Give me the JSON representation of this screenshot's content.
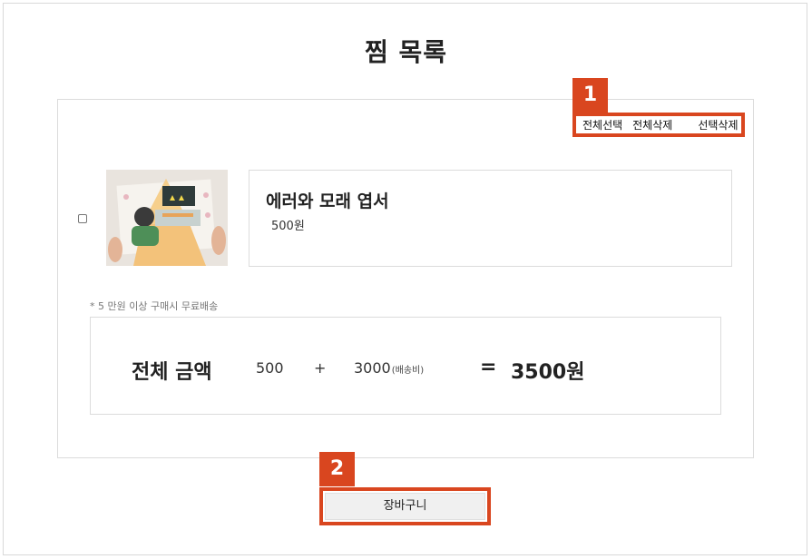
{
  "page": {
    "title": "찜 목록"
  },
  "annotations": {
    "badge1": "1",
    "badge2": "2"
  },
  "actions": {
    "select_all": "전체선택",
    "delete_all": "전체삭제",
    "delete_selected": "선택삭제"
  },
  "item": {
    "name": "에러와 모래 엽서",
    "price": "500원",
    "checked": false
  },
  "shipping_note": "* 5 만원 이상 구매시 무료배송",
  "total": {
    "label": "전체 금액",
    "subtotal": "500",
    "plus": "+",
    "shipping": "3000",
    "shipping_note": "(배송비)",
    "equals": "=",
    "grand_total": "3500원"
  },
  "cart_button": {
    "label": "장바구니"
  },
  "colors": {
    "annotation": "#d9461f",
    "border": "#dcdcdc",
    "button_bg": "#f0f0f0"
  }
}
